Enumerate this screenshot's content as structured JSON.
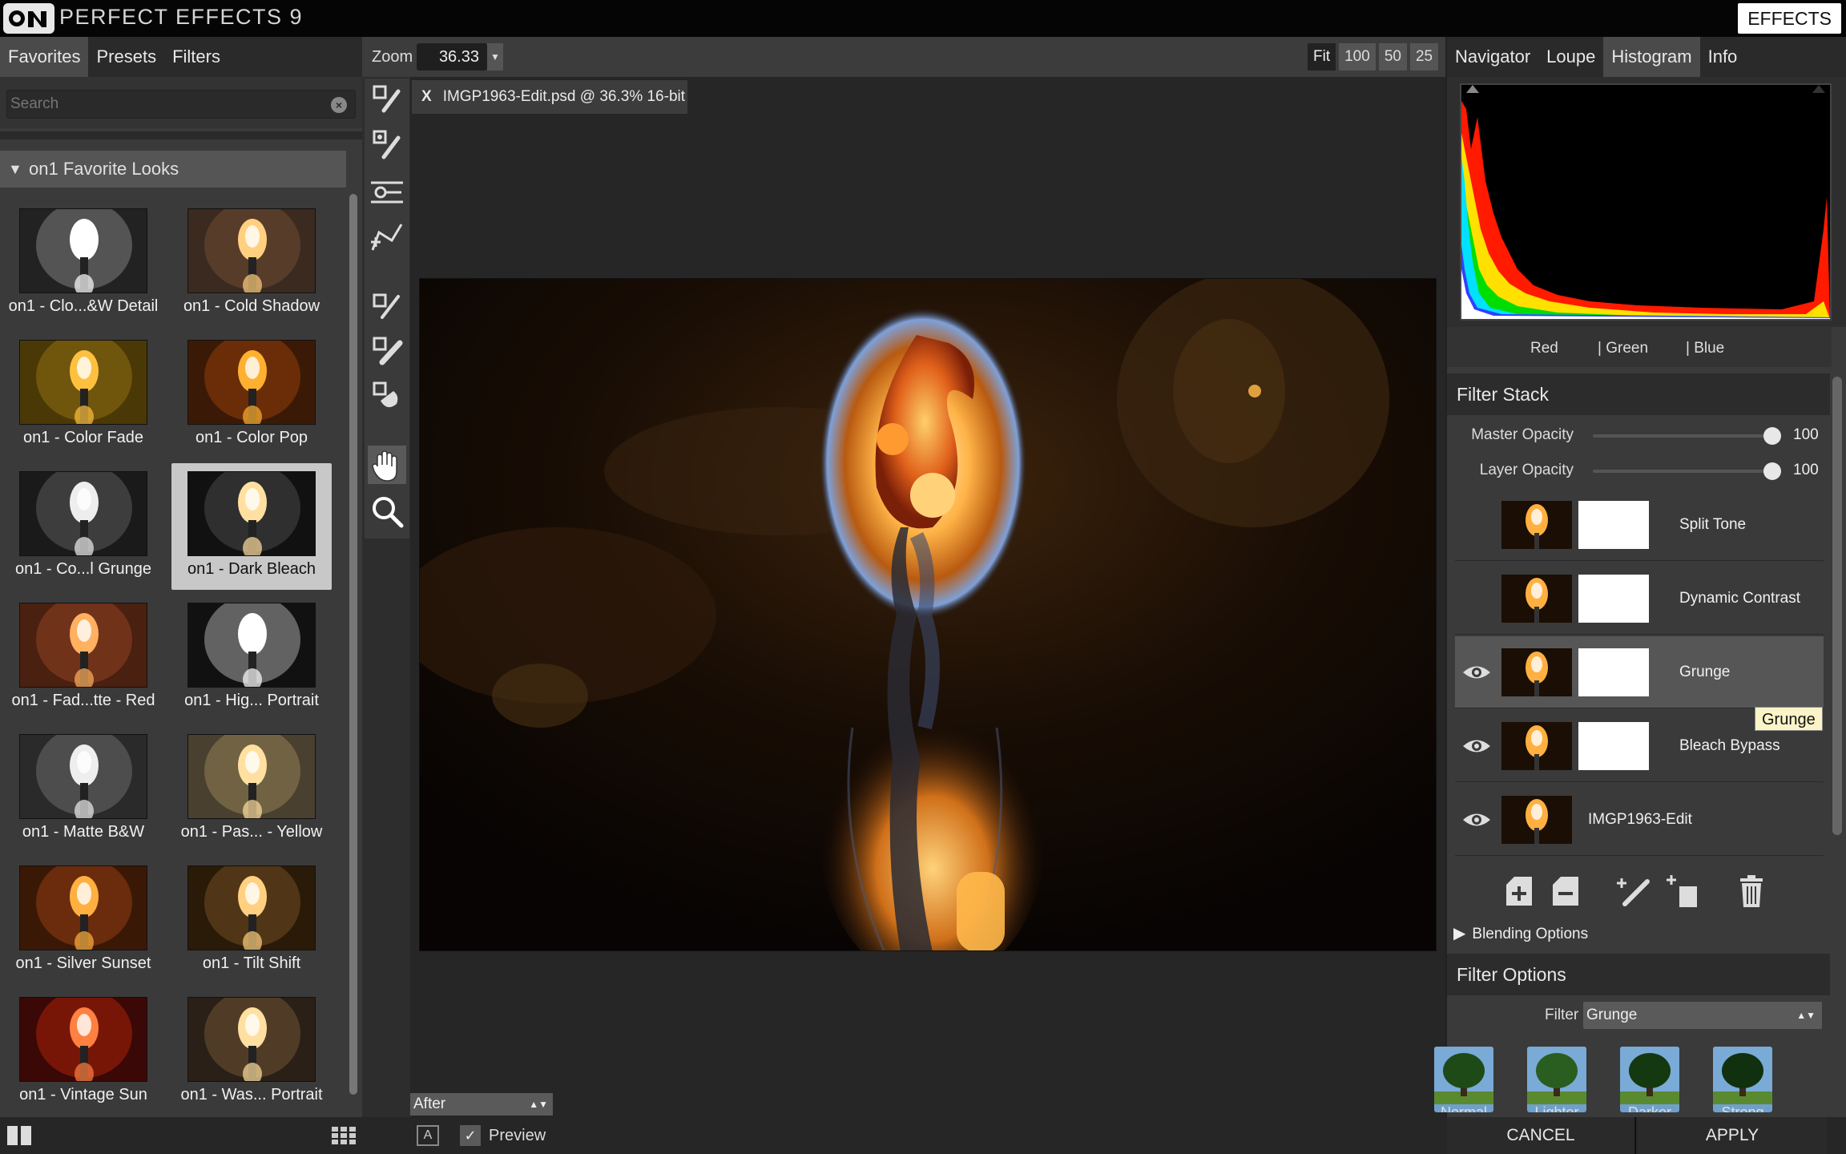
{
  "app": {
    "title": "PERFECT EFFECTS 9",
    "effects_button": "EFFECTS"
  },
  "left_panel": {
    "tabs": [
      "Favorites",
      "Presets",
      "Filters"
    ],
    "active_tab": "Favorites",
    "search_placeholder": "Search",
    "favorites_header": "on1 Favorite Looks",
    "looks": [
      {
        "label": "on1 - Clo...&W Detail",
        "tone": "bw"
      },
      {
        "label": "on1 - Cold Shadow",
        "tone": "cold"
      },
      {
        "label": "on1 - Color Fade",
        "tone": "fade"
      },
      {
        "label": "on1 - Color Pop",
        "tone": "pop"
      },
      {
        "label": "on1 - Co...l Grunge",
        "tone": "grunge"
      },
      {
        "label": "on1 - Dark Bleach",
        "tone": "dark",
        "selected": true
      },
      {
        "label": "on1 - Fad...tte - Red",
        "tone": "red"
      },
      {
        "label": "on1 - Hig... Portrait",
        "tone": "bw2"
      },
      {
        "label": "on1 - Matte B&W",
        "tone": "matte"
      },
      {
        "label": "on1 - Pas... - Yellow",
        "tone": "pastel"
      },
      {
        "label": "on1 - Silver Sunset",
        "tone": "sunset"
      },
      {
        "label": "on1 - Tilt Shift",
        "tone": "tilt"
      },
      {
        "label": "on1 - Vintage Sun",
        "tone": "vintage"
      },
      {
        "label": "on1 - Was... Portrait",
        "tone": "washed"
      }
    ]
  },
  "center": {
    "zoom_label": "Zoom",
    "zoom_value": "36.33",
    "zoom_buttons": [
      "Fit",
      "100",
      "50",
      "25"
    ],
    "doc_tab_close": "X",
    "doc_tab": "IMGP1963-Edit.psd @ 36.3% 16-bit",
    "view_mode": "After",
    "ab_label": "A",
    "preview_check": "✓",
    "preview_label": "Preview",
    "tools": [
      "brush-icon",
      "masking-bug-icon",
      "gradient-icon",
      "perspective-icon",
      "retouch-icon",
      "eraser-icon",
      "blur-icon",
      "hand-icon",
      "zoom-icon"
    ]
  },
  "right_panel": {
    "tabs": [
      "Navigator",
      "Loupe",
      "Histogram",
      "Info"
    ],
    "active_tab": "Histogram",
    "channels": [
      "Red",
      "| Green",
      "| Blue"
    ],
    "filter_stack": {
      "title": "Filter Stack",
      "master_opacity_label": "Master Opacity",
      "master_opacity": "100",
      "layer_opacity_label": "Layer Opacity",
      "layer_opacity": "100",
      "layers": [
        {
          "name": "Split Tone",
          "visible": false,
          "selected": false
        },
        {
          "name": "Dynamic Contrast",
          "visible": false,
          "selected": false
        },
        {
          "name": "Grunge",
          "visible": true,
          "selected": true
        },
        {
          "name": "Bleach Bypass",
          "visible": true,
          "selected": false
        },
        {
          "name": "IMGP1963-Edit",
          "visible": true,
          "selected": false,
          "base": true
        }
      ],
      "tooltip": "Grunge",
      "blending_options": "Blending Options"
    },
    "filter_options": {
      "title": "Filter Options",
      "filter_label": "Filter",
      "filter_value": "Grunge",
      "presets": [
        "Normal",
        "Lighter",
        "Darker",
        "Strong"
      ]
    },
    "cancel": "CANCEL",
    "apply": "APPLY"
  },
  "colors": {
    "accent_selected": "#5a5a5a",
    "background": "#2f2f2f",
    "titlebar": "#050505"
  }
}
